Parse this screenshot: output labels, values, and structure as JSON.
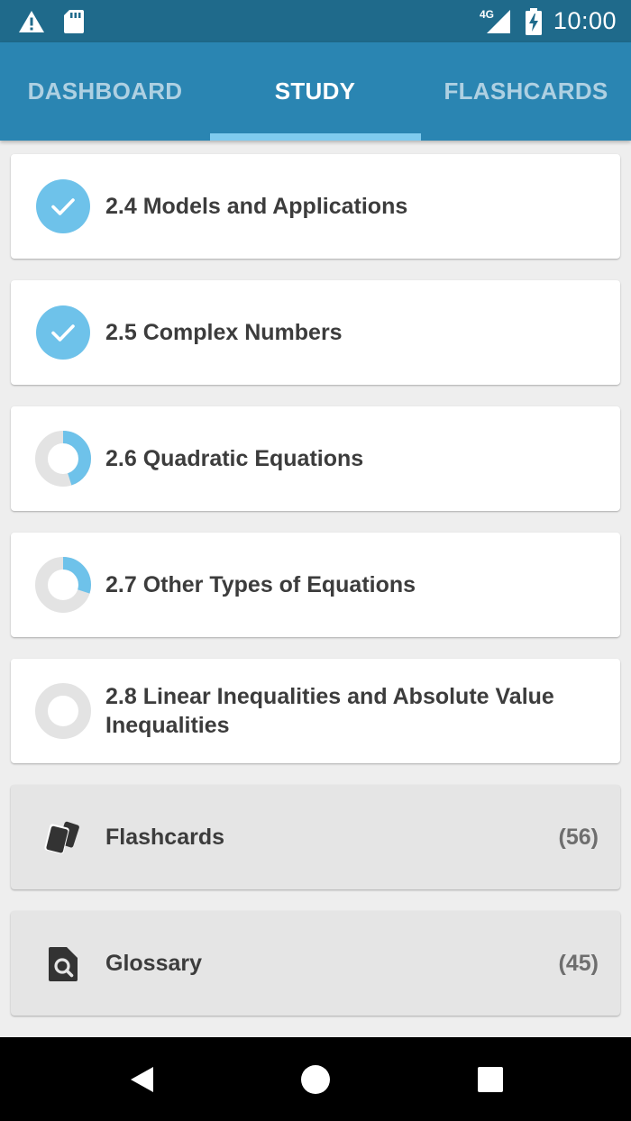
{
  "status_bar": {
    "time": "10:00",
    "network": "4G",
    "icons": [
      "warning-icon",
      "sd-card-icon",
      "signal-icon",
      "battery-charging-icon"
    ]
  },
  "tabs": [
    {
      "label": "DASHBOARD",
      "active": false
    },
    {
      "label": "STUDY",
      "active": true
    },
    {
      "label": "FLASHCARDS",
      "active": false
    }
  ],
  "sections": [
    {
      "title": "2.4 Models and Applications",
      "progress": 1.0,
      "status": "complete"
    },
    {
      "title": "2.5 Complex Numbers",
      "progress": 1.0,
      "status": "complete"
    },
    {
      "title": "2.6 Quadratic Equations",
      "progress": 0.45,
      "status": "in-progress"
    },
    {
      "title": "2.7 Other Types of Equations",
      "progress": 0.3,
      "status": "in-progress"
    },
    {
      "title": "2.8 Linear Inequalities and Absolute Value Inequalities",
      "progress": 0.0,
      "status": "not-started"
    }
  ],
  "tools": [
    {
      "label": "Flashcards",
      "count": "(56)",
      "icon": "flashcards-icon"
    },
    {
      "label": "Glossary",
      "count": "(45)",
      "icon": "glossary-search-icon"
    }
  ],
  "colors": {
    "status_bar": "#1f6a8b",
    "app_bar": "#2a85b2",
    "tab_indicator": "#7fcbef",
    "progress": "#6ec2ea",
    "progress_track": "#e3e3e3",
    "background": "#eeeeee"
  },
  "nav_bar": {
    "icons": [
      "back-icon",
      "home-icon",
      "recents-icon"
    ]
  }
}
